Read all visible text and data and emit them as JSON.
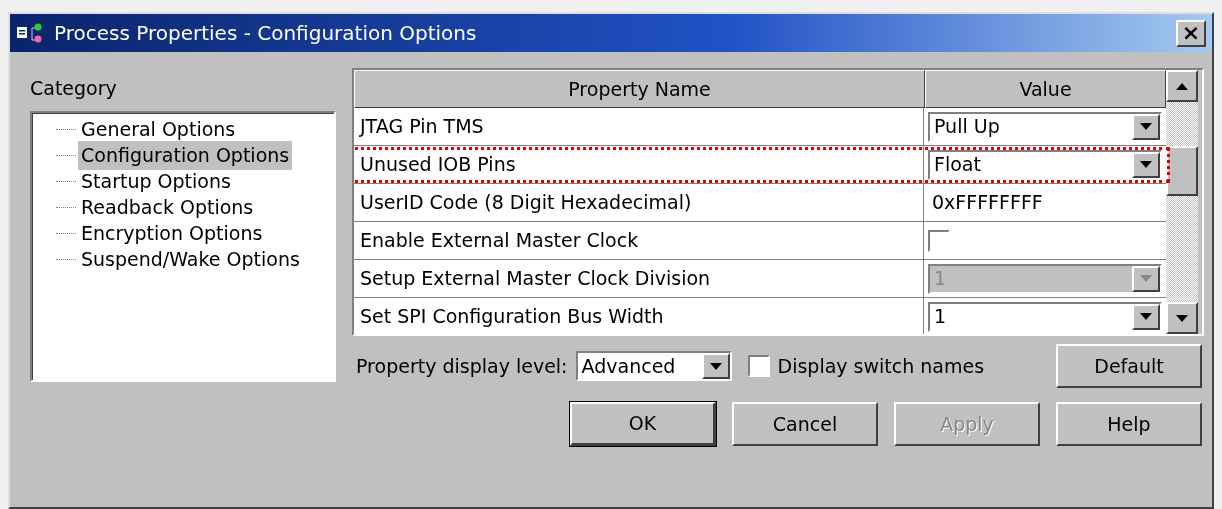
{
  "window": {
    "title": "Process Properties - Configuration Options",
    "close": "×"
  },
  "category": {
    "label": "Category",
    "items": [
      {
        "label": "General Options",
        "selected": false
      },
      {
        "label": "Configuration Options",
        "selected": true
      },
      {
        "label": "Startup Options",
        "selected": false
      },
      {
        "label": "Readback Options",
        "selected": false
      },
      {
        "label": "Encryption Options",
        "selected": false
      },
      {
        "label": "Suspend/Wake Options",
        "selected": false
      }
    ]
  },
  "table": {
    "columns": [
      "Property Name",
      "Value"
    ],
    "rows": [
      {
        "name": "JTAG Pin TMS",
        "kind": "dropdown",
        "value": "Pull Up",
        "disabled": false,
        "highlighted": false
      },
      {
        "name": "Unused IOB Pins",
        "kind": "dropdown",
        "value": "Float",
        "disabled": false,
        "highlighted": true
      },
      {
        "name": "UserID Code (8 Digit Hexadecimal)",
        "kind": "text",
        "value": "0xFFFFFFFF",
        "highlighted": false
      },
      {
        "name": "Enable External Master Clock",
        "kind": "checkbox",
        "checked": false,
        "highlighted": false
      },
      {
        "name": "Setup External Master Clock Division",
        "kind": "dropdown",
        "value": "1",
        "disabled": true,
        "highlighted": false
      },
      {
        "name": "Set SPI Configuration Bus Width",
        "kind": "dropdown",
        "value": "1",
        "disabled": false,
        "highlighted": false
      }
    ]
  },
  "display_level": {
    "label": "Property display level:",
    "value": "Advanced"
  },
  "switch_names": {
    "label": "Display switch names",
    "checked": false
  },
  "buttons": [
    {
      "label": "Default",
      "disabled": false,
      "default": false
    },
    {
      "label": "OK",
      "disabled": false,
      "default": true
    },
    {
      "label": "Cancel",
      "disabled": false,
      "default": false
    },
    {
      "label": "Apply",
      "disabled": true,
      "default": false
    },
    {
      "label": "Help",
      "disabled": false,
      "default": false
    }
  ]
}
